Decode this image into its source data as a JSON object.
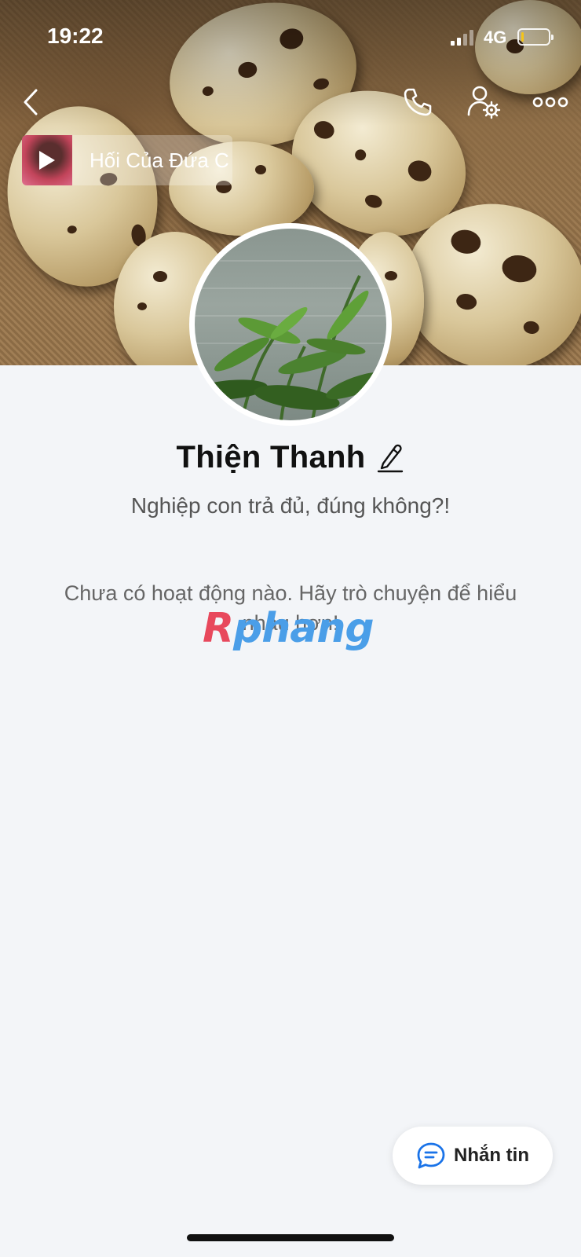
{
  "status_bar": {
    "time": "19:22",
    "network": "4G",
    "battery_level": 0.1,
    "battery_color": "#f5c518"
  },
  "top_bar": {
    "back_icon": "chevron-left-icon",
    "call_icon": "phone-icon",
    "user_settings_icon": "user-settings-icon",
    "more_icon": "more-dots-icon"
  },
  "music": {
    "title": "Hối Của Đứa C",
    "play_icon": "play-icon"
  },
  "profile": {
    "name": "Thiện Thanh",
    "edit_icon": "pencil-icon",
    "status": "Nghiệp con trả đủ, đúng không?!"
  },
  "feed": {
    "empty_message": "Chưa có hoạt động nào. Hãy trò chuyện để hiểu nhau hơn!"
  },
  "watermark": {
    "part1": "R",
    "part2": "phang"
  },
  "message_button": {
    "label": "Nhắn tin",
    "icon": "chat-bubble-icon",
    "accent": "#1a73e8"
  }
}
